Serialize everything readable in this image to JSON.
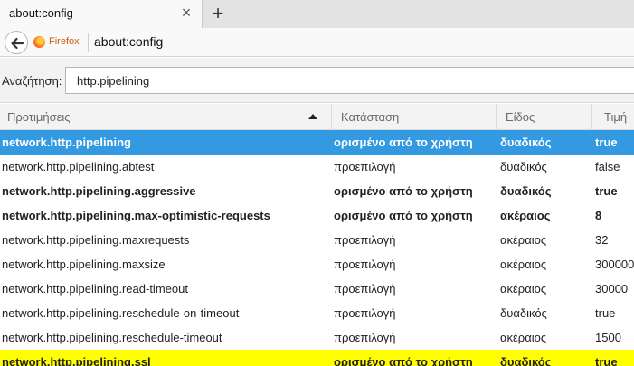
{
  "tab": {
    "title": "about:config",
    "close_glyph": "×",
    "new_glyph": "+"
  },
  "nav": {
    "identity_label": "Firefox",
    "url": "about:config"
  },
  "search": {
    "label": "Αναζήτηση:",
    "value": "http.pipelining"
  },
  "columns": {
    "name": "Προτιμήσεις",
    "status": "Κατάσταση",
    "type": "Είδος",
    "value": "Τιμή"
  },
  "rows": [
    {
      "name": "network.http.pipelining",
      "status": "ορισμένο από το χρήστη",
      "type": "δυαδικός",
      "value": "true"
    },
    {
      "name": "network.http.pipelining.abtest",
      "status": "προεπιλογή",
      "type": "δυαδικός",
      "value": "false"
    },
    {
      "name": "network.http.pipelining.aggressive",
      "status": "ορισμένο από το χρήστη",
      "type": "δυαδικός",
      "value": "true"
    },
    {
      "name": "network.http.pipelining.max-optimistic-requests",
      "status": "ορισμένο από το χρήστη",
      "type": "ακέραιος",
      "value": "8"
    },
    {
      "name": "network.http.pipelining.maxrequests",
      "status": "προεπιλογή",
      "type": "ακέραιος",
      "value": "32"
    },
    {
      "name": "network.http.pipelining.maxsize",
      "status": "προεπιλογή",
      "type": "ακέραιος",
      "value": "300000"
    },
    {
      "name": "network.http.pipelining.read-timeout",
      "status": "προεπιλογή",
      "type": "ακέραιος",
      "value": "30000"
    },
    {
      "name": "network.http.pipelining.reschedule-on-timeout",
      "status": "προεπιλογή",
      "type": "δυαδικός",
      "value": "true"
    },
    {
      "name": "network.http.pipelining.reschedule-timeout",
      "status": "προεπιλογή",
      "type": "ακέραιος",
      "value": "1500"
    },
    {
      "name": "network.http.pipelining.ssl",
      "status": "ορισμένο από το χρήστη",
      "type": "δυαδικός",
      "value": "true"
    }
  ],
  "colors": {
    "selected_row": "#3399e1",
    "highlighted_row": "#ffff00"
  },
  "icons": {
    "back": "back-arrow-icon",
    "browser": "firefox-icon",
    "sort": "sort-ascending-icon"
  }
}
